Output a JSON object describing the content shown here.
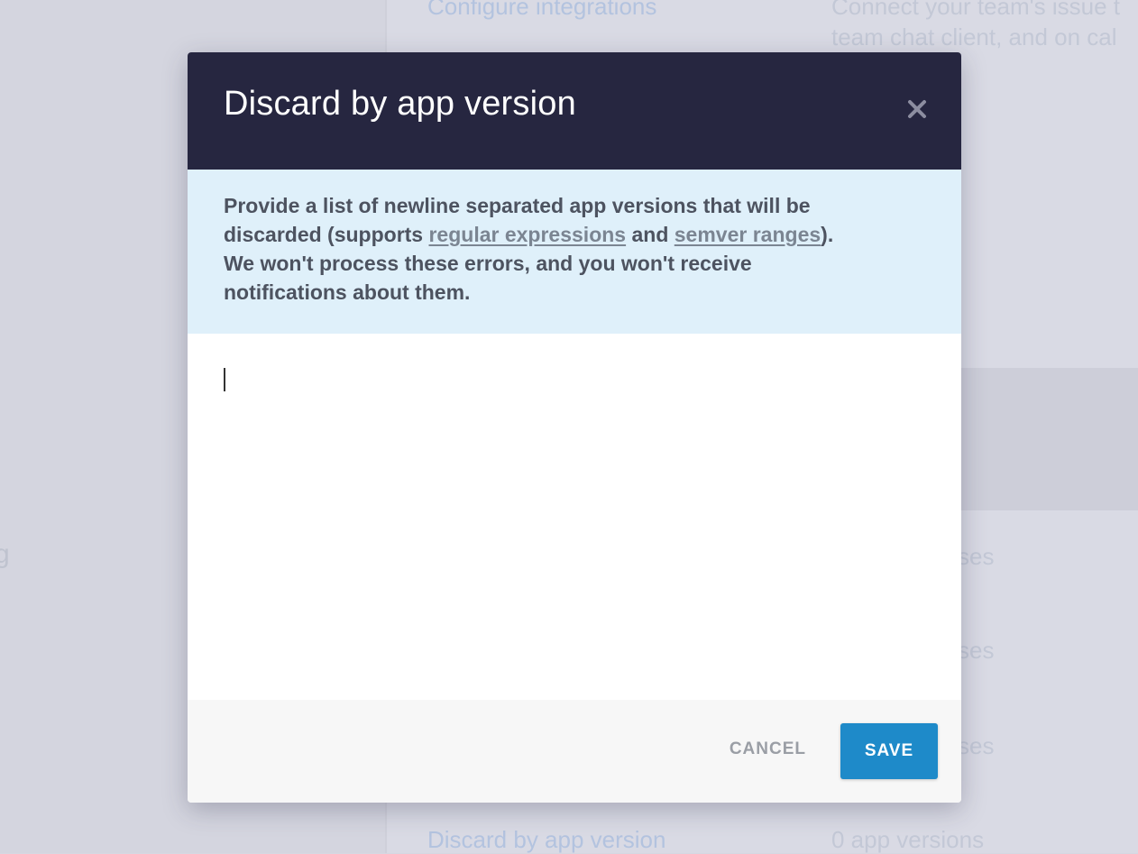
{
  "background": {
    "rows": [
      {
        "left": "Configure integrations",
        "right_line1": "Connect your team's issue t",
        "right_line2": "team chat client, and on cal"
      },
      {
        "right": "ses"
      },
      {
        "right": "ses"
      },
      {
        "right": "ses"
      },
      {
        "left": "Discard by app version",
        "right": "0 app versions"
      }
    ],
    "partial_letter": "g"
  },
  "modal": {
    "title": "Discard by app version",
    "close_icon": "close-icon",
    "info": {
      "text_before": "Provide a list of newline separated app versions that will be discarded (supports ",
      "link1": "regular expressions",
      "text_between": " and ",
      "link2": "semver ranges",
      "text_after": "). We won't process these errors, and you won't receive notifications about them."
    },
    "textarea_value": "",
    "cancel_label": "CANCEL",
    "save_label": "SAVE"
  },
  "colors": {
    "header_bg": "#262640",
    "info_bg": "#dff0fa",
    "save_bg": "#1e8ac9",
    "overlay_bg": "#d6d7e1"
  }
}
